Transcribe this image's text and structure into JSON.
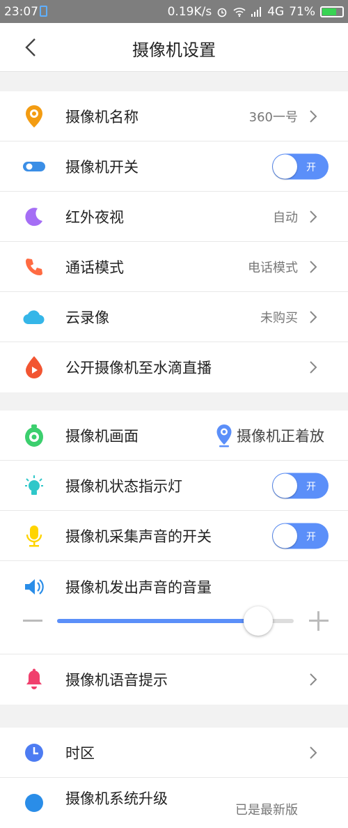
{
  "status_bar": {
    "time": "23:07",
    "right_text": "0.19K/s ⏰ 📶 4G 71%",
    "net_speed": "0.19K/s",
    "signal_label": "4G",
    "battery_percent": "71%",
    "battery_level": 0.71
  },
  "header": {
    "title": "摄像机设置"
  },
  "colors": {
    "accent": "#5b8ff9",
    "icon_orange": "#f39c12",
    "icon_blue": "#3a8ee6",
    "icon_purple": "#a56ef5",
    "icon_coral": "#ff6b42",
    "icon_cyan": "#35b6e8",
    "icon_green": "#3ccf6e",
    "icon_teal": "#2ec7c9",
    "icon_yellow": "#ffd400",
    "icon_red": "#f0406d"
  },
  "group1": {
    "camera_name": {
      "label": "摄像机名称",
      "value": "360一号",
      "icon": "camera-pin-icon"
    },
    "camera_switch": {
      "label": "摄像机开关",
      "toggle": "开",
      "icon": "toggle-icon"
    },
    "night_vision": {
      "label": "红外夜视",
      "value": "自动",
      "icon": "moon-icon"
    },
    "call_mode": {
      "label": "通话模式",
      "value": "电话模式",
      "icon": "phone-icon"
    },
    "cloud_record": {
      "label": "云录像",
      "value": "未购买",
      "icon": "cloud-icon"
    },
    "public_live": {
      "label": "公开摄像机至水滴直播",
      "icon": "drop-play-icon"
    }
  },
  "group2": {
    "camera_view": {
      "label": "摄像机画面",
      "value": "摄像机正着放",
      "icon": "camera-lens-icon"
    },
    "status_light": {
      "label": "摄像机状态指示灯",
      "toggle": "开",
      "icon": "bulb-icon"
    },
    "sound_capture": {
      "label": "摄像机采集声音的开关",
      "toggle": "开",
      "icon": "mic-icon"
    },
    "volume": {
      "label": "摄像机发出声音的音量",
      "level": 0.85,
      "icon": "speaker-icon"
    },
    "voice_prompt": {
      "label": "摄像机语音提示",
      "icon": "bell-icon"
    }
  },
  "group3": {
    "timezone": {
      "label": "时区",
      "icon": "clock-icon"
    },
    "upgrade": {
      "label": "摄像机系统升级",
      "value": "已是最新版",
      "icon": "upgrade-icon"
    }
  }
}
